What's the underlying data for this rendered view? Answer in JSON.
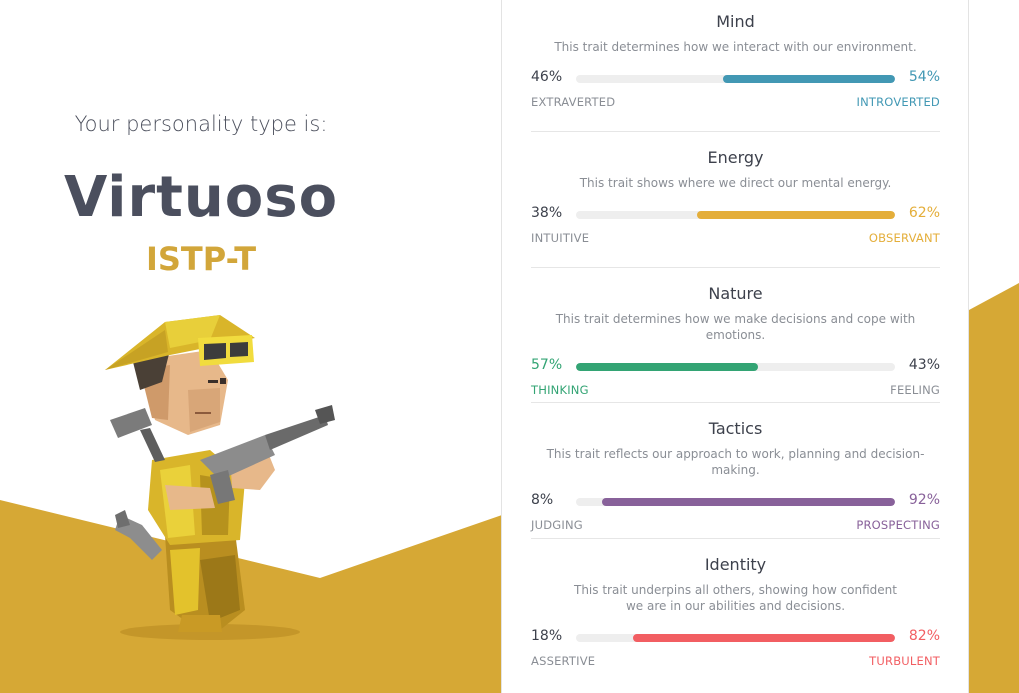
{
  "intro": "Your personality type is:",
  "type_name": "Virtuoso",
  "type_code": "ISTP-T",
  "colors": {
    "gold": "#d6a835",
    "mind": "#4298b4",
    "energy": "#e4ae3a",
    "nature": "#33a474",
    "tactics": "#88619a",
    "identity": "#f25e62"
  },
  "traits": [
    {
      "title": "Mind",
      "description": "This trait determines how we interact with our environment.",
      "left_label": "EXTRAVERTED",
      "left_pct": "46%",
      "right_label": "INTROVERTED",
      "right_pct": "54%",
      "dominant": "right",
      "fill_fraction": 0.54,
      "color_key": "mind"
    },
    {
      "title": "Energy",
      "description": "This trait shows where we direct our mental energy.",
      "left_label": "INTUITIVE",
      "left_pct": "38%",
      "right_label": "OBSERVANT",
      "right_pct": "62%",
      "dominant": "right",
      "fill_fraction": 0.62,
      "color_key": "energy"
    },
    {
      "title": "Nature",
      "description": "This trait determines how we make decisions and cope with emotions.",
      "left_label": "THINKING",
      "left_pct": "57%",
      "right_label": "FEELING",
      "right_pct": "43%",
      "dominant": "left",
      "fill_fraction": 0.57,
      "color_key": "nature"
    },
    {
      "title": "Tactics",
      "description": "This trait reflects our approach to work, planning and decision-making.",
      "left_label": "JUDGING",
      "left_pct": "8%",
      "right_label": "PROSPECTING",
      "right_pct": "92%",
      "dominant": "right",
      "fill_fraction": 0.92,
      "color_key": "tactics"
    },
    {
      "title": "Identity",
      "description": "This trait underpins all others, showing how confident we are in our abilities and decisions.",
      "left_label": "ASSERTIVE",
      "left_pct": "18%",
      "right_label": "TURBULENT",
      "right_pct": "82%",
      "dominant": "right",
      "fill_fraction": 0.82,
      "color_key": "identity"
    }
  ]
}
